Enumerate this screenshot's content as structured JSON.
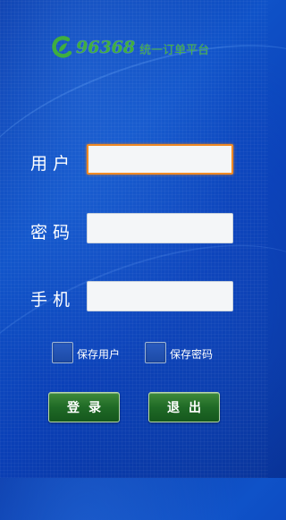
{
  "logo": {
    "number": "96368",
    "text": "统一订单平台",
    "brand_color": "#3fae3f"
  },
  "form": {
    "username": {
      "label": "用户",
      "value": "",
      "placeholder": ""
    },
    "password": {
      "label": "密码",
      "value": "",
      "placeholder": ""
    },
    "phone": {
      "label": "手机",
      "value": "",
      "placeholder": ""
    }
  },
  "options": {
    "save_user": {
      "label": "保存用户",
      "checked": false
    },
    "save_password": {
      "label": "保存密码",
      "checked": false
    }
  },
  "buttons": {
    "login": "登录",
    "exit": "退出"
  },
  "colors": {
    "background": "#0f52c8",
    "focus_border": "#f08a24",
    "button": "#1f6a26"
  }
}
